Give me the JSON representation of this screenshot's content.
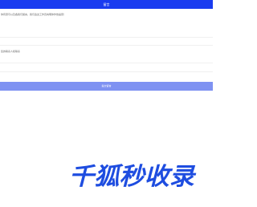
{
  "header": {
    "title": "留言"
  },
  "form": {
    "intro": "你有意可以及各我们留言，我们会这工作员向明你作告提意！",
    "contact_label": "您的联系人和联系",
    "submit_label": "提交留言"
  },
  "watermark": {
    "text": "千狐秒收录",
    "color": "#1e4de0"
  }
}
